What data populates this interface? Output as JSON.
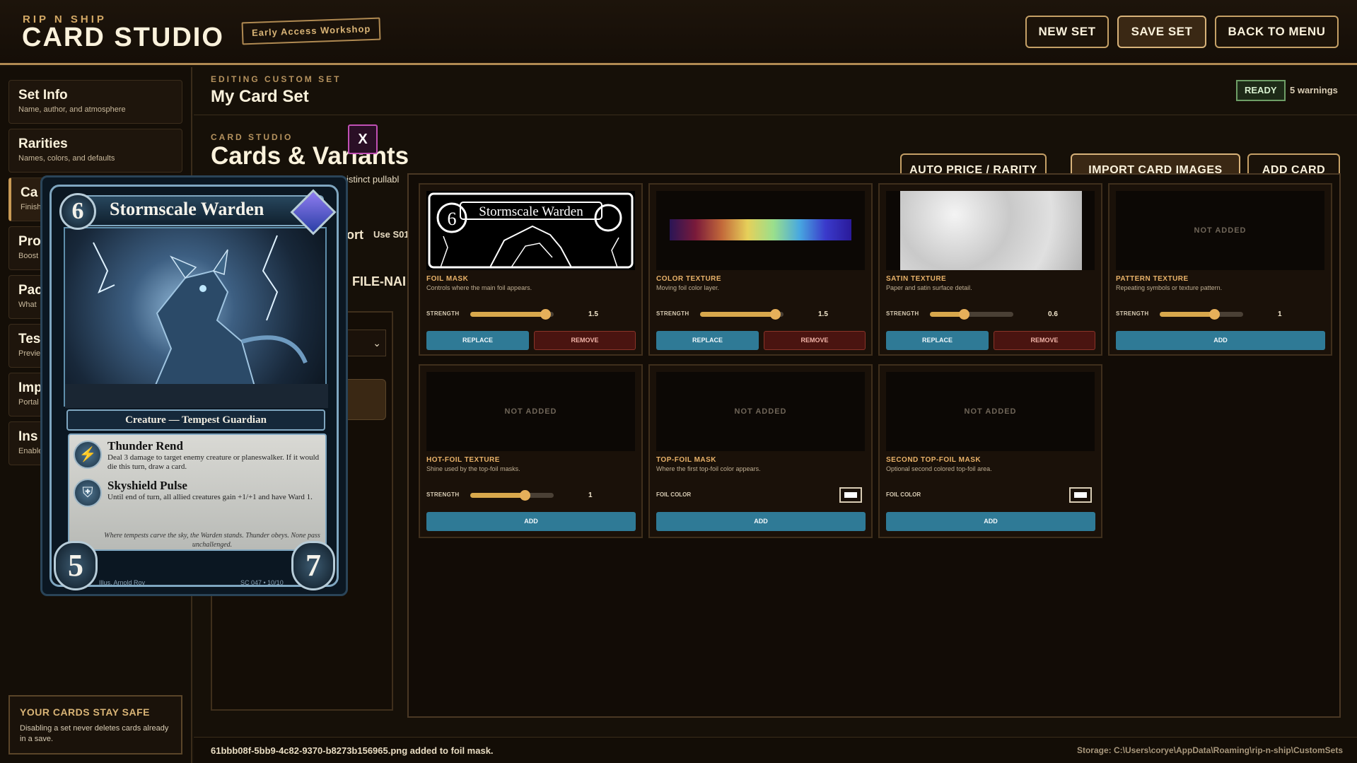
{
  "header": {
    "brand_small": "RIP N SHIP",
    "brand_big": "CARD STUDIO",
    "badge": "Early Access Workshop",
    "buttons": {
      "new_set": "NEW SET",
      "save_set": "SAVE SET",
      "back_to_menu": "BACK TO MENU"
    }
  },
  "sidebar": {
    "items": [
      {
        "label": "Set Info",
        "sub": "Name, author, and atmosphere"
      },
      {
        "label": "Rarities",
        "sub": "Names, colors, and defaults"
      },
      {
        "label": "Ca",
        "sub": "Finish"
      },
      {
        "label": "Pro",
        "sub": "Boost"
      },
      {
        "label": "Pac",
        "sub": "What"
      },
      {
        "label": "Tes",
        "sub": "Previe"
      },
      {
        "label": "Imp",
        "sub": "Portal"
      },
      {
        "label": "Ins",
        "sub": "Enable"
      }
    ],
    "safe_title": "YOUR CARDS STAY SAFE",
    "safe_text": "Disabling a set never deletes cards already in a save."
  },
  "edit": {
    "sub": "EDITING CUSTOM SET",
    "title": "My Card Set",
    "ready": "READY",
    "warnings": "5 warnings"
  },
  "studio": {
    "sub": "CARD STUDIO",
    "title": "Cards & Variants",
    "close": "X",
    "behind_text_1": "istinct pullabl",
    "behind_text_2": "ort",
    "behind_text_3": "Use S01",
    "behind_text_4": "FILE-NAI"
  },
  "actions": {
    "auto_price": "AUTO PRICE / RARITY",
    "import": "IMPORT CARD IMAGES",
    "add_card": "ADD CARD"
  },
  "layers": [
    {
      "title": "FOIL MASK",
      "desc": "Controls where the main foil appears.",
      "strength_label": "STRENGTH",
      "strength": "1.5",
      "strength_level": 0.9,
      "primary": "REPLACE",
      "secondary": "REMOVE",
      "added": true
    },
    {
      "title": "COLOR TEXTURE",
      "desc": "Moving foil color layer.",
      "strength_label": "STRENGTH",
      "strength": "1.5",
      "strength_level": 0.9,
      "primary": "REPLACE",
      "secondary": "REMOVE",
      "added": true
    },
    {
      "title": "SATIN TEXTURE",
      "desc": "Paper and satin surface detail.",
      "strength_label": "STRENGTH",
      "strength": "0.6",
      "strength_level": 0.41,
      "primary": "REPLACE",
      "secondary": "REMOVE",
      "added": true
    },
    {
      "title": "PATTERN TEXTURE",
      "desc": "Repeating symbols or texture pattern.",
      "strength_label": "STRENGTH",
      "strength": "1",
      "strength_level": 0.65,
      "primary": "ADD",
      "not_added": "NOT ADDED",
      "added": false
    },
    {
      "title": "HOT-FOIL TEXTURE",
      "desc": "Shine used by the top-foil masks.",
      "strength_label": "STRENGTH",
      "strength": "1",
      "strength_level": 0.65,
      "primary": "ADD",
      "not_added": "NOT ADDED",
      "added": false
    },
    {
      "title": "TOP-FOIL MASK",
      "desc": "Where the first top-foil color appears.",
      "color_label": "FOIL COLOR",
      "foil_color": "#ffffff",
      "primary": "ADD",
      "not_added": "NOT ADDED",
      "added": false
    },
    {
      "title": "SECOND TOP-FOIL MASK",
      "desc": "Optional second colored top-foil area.",
      "color_label": "FOIL COLOR",
      "foil_color": "#ffffff",
      "primary": "ADD",
      "not_added": "NOT ADDED",
      "added": false
    }
  ],
  "card": {
    "name": "Stormscale Warden",
    "cost": "6",
    "type": "Creature — Tempest Guardian",
    "ability1_title": "Thunder Rend",
    "ability1_text": "Deal 3 damage to target enemy creature or planeswalker. If it would die this turn, draw a card.",
    "ability2_title": "Skyshield Pulse",
    "ability2_text": "Until end of turn, all allied creatures gain +1/+1 and have Ward 1.",
    "flavor": "Where tempests carve the sky, the Warden stands. Thunder obeys. None pass unchallenged.",
    "power": "5",
    "toughness": "7",
    "illus": "Illus. Arnold Roy",
    "set_no": "SC 047 • 10/10"
  },
  "footer": {
    "status": "61bbb08f-5bb9-4c82-9370-b8273b156965.png added to foil mask.",
    "storage": "Storage: C:\\Users\\corye\\AppData\\Roaming\\rip-n-ship\\CustomSets"
  }
}
